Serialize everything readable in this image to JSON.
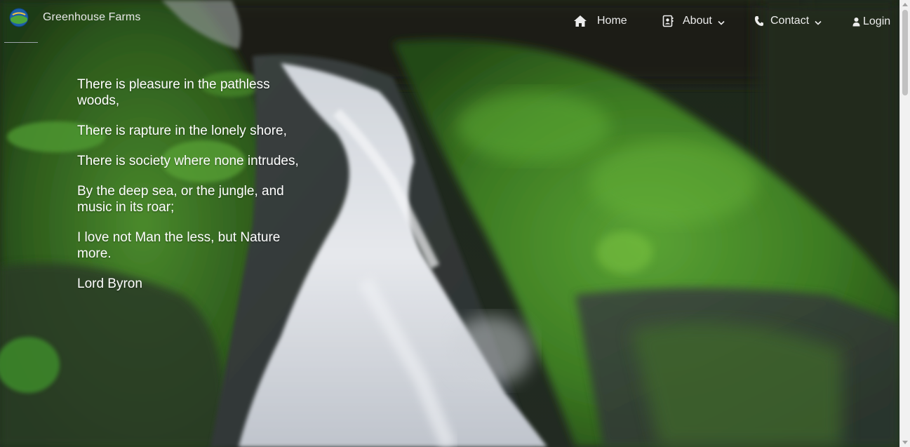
{
  "brand": {
    "name": "Greenhouse Farms",
    "logo_icon": "globe-logo-icon"
  },
  "nav": {
    "items": [
      {
        "label": "Home",
        "icon": "home-icon"
      },
      {
        "label": "About",
        "icon": "contact-card-icon",
        "dropdown": true
      },
      {
        "label": "Contact",
        "icon": "phone-icon",
        "dropdown": true
      },
      {
        "label": "Login",
        "icon": "user-icon"
      }
    ]
  },
  "hero": {
    "background": "waterfall-video-background",
    "quote_lines": [
      "There is pleasure in the pathless woods,",
      "There is rapture in the lonely shore,",
      "There is society where none intrudes,",
      "By the deep sea, or the jungle, and music in its roar;",
      "I love not Man the less, but Nature more."
    ],
    "author": "Lord Byron"
  },
  "colors": {
    "nav_text": "#ececec",
    "quote_text": "#ffffff",
    "foliage": "#3f7a24",
    "water": "#d9dde3"
  }
}
